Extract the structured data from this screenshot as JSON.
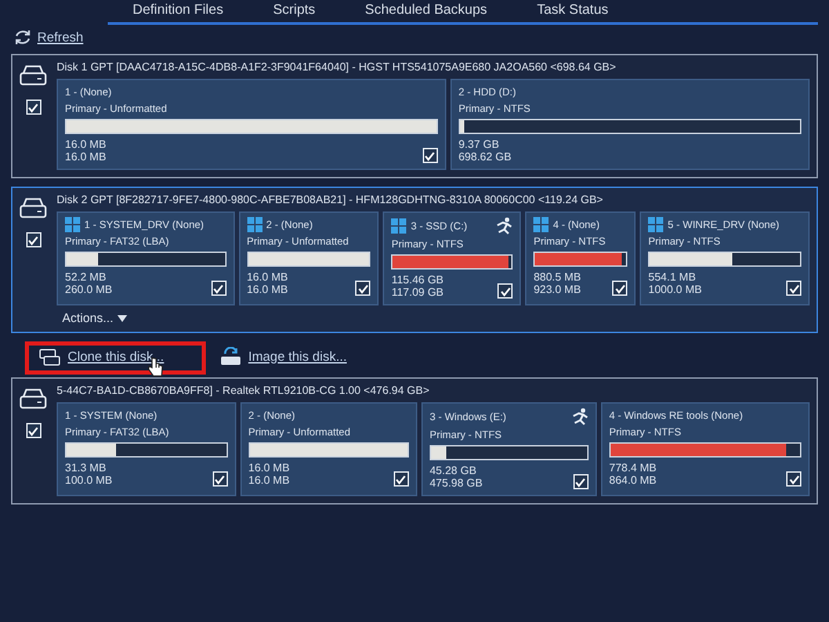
{
  "tabs": [
    {
      "label": "Definition Files",
      "selected": false
    },
    {
      "label": "Scripts",
      "selected": false
    },
    {
      "label": "Scheduled Backups",
      "selected": false
    },
    {
      "label": "Task Status",
      "selected": false
    }
  ],
  "refresh": {
    "label": "Refresh"
  },
  "disks": [
    {
      "header": "Disk 1 GPT [DAAC4718-A15C-4DB8-A1F2-3F9041F64040] - HGST HTS541075A9E680 JA2OA560  <698.64 GB>",
      "selected": false,
      "checked": true,
      "partitions": [
        {
          "name": "1 - (None)",
          "type": "Primary - Unformatted",
          "kind": "plain",
          "boot": false,
          "level": 1,
          "color": "#e4e4e0",
          "used": "16.0 MB",
          "total": "16.0 MB",
          "checked": true
        },
        {
          "name": "2 - HDD (D:)",
          "type": "Primary - NTFS",
          "kind": "plain",
          "boot": false,
          "level": 0.013,
          "color": "#e4e4e0",
          "used": "9.37 GB",
          "total": "698.62 GB"
        }
      ]
    },
    {
      "header": "Disk 2 GPT [8F282717-9FE7-4800-980C-AFBE7B08AB21] - HFM128GDHTNG-8310A 80060C00  <119.24 GB>",
      "selected": true,
      "checked": true,
      "actions": "Actions...",
      "partitions": [
        {
          "name": "1 - SYSTEM_DRV (None)",
          "type": "Primary - FAT32 (LBA)",
          "kind": "windows",
          "boot": false,
          "level": 0.2,
          "color": "#e4e4e0",
          "used": "52.2 MB",
          "total": "260.0 MB",
          "checked": true
        },
        {
          "name": "2 - (None)",
          "type": "Primary - Unformatted",
          "kind": "windows",
          "boot": false,
          "level": 1,
          "color": "#e4e4e0",
          "used": "16.0 MB",
          "total": "16.0 MB",
          "checked": true
        },
        {
          "name": "3 - SSD (C:)",
          "type": "Primary - NTFS",
          "kind": "windows",
          "boot": true,
          "level": 0.98,
          "color": "#e0443c",
          "used": "115.46 GB",
          "total": "117.09 GB",
          "checked": true
        },
        {
          "name": "4 - (None)",
          "type": "Primary - NTFS",
          "kind": "windows",
          "boot": false,
          "level": 0.95,
          "color": "#e0443c",
          "used": "880.5 MB",
          "total": "923.0 MB",
          "checked": true
        },
        {
          "name": "5 - WINRE_DRV (None)",
          "type": "Primary - NTFS",
          "kind": "windows",
          "boot": false,
          "level": 0.55,
          "color": "#e4e4e0",
          "used": "554.1 MB",
          "total": "1000.0 MB",
          "checked": true
        }
      ]
    },
    {
      "header": "5-44C7-BA1D-CB8670BA9FF8] - Realtek RTL9210B-CG 1.00  <476.94 GB>",
      "selected": false,
      "checked": true,
      "partitions": [
        {
          "name": "1 - SYSTEM (None)",
          "type": "Primary - FAT32 (LBA)",
          "kind": "plain",
          "boot": false,
          "level": 0.31,
          "color": "#e4e4e0",
          "used": "31.3 MB",
          "total": "100.0 MB",
          "checked": true
        },
        {
          "name": "2 - (None)",
          "type": "Primary - Unformatted",
          "kind": "plain",
          "boot": false,
          "level": 1,
          "color": "#e4e4e0",
          "used": "16.0 MB",
          "total": "16.0 MB",
          "checked": true
        },
        {
          "name": "3 - Windows (E:)",
          "type": "Primary - NTFS",
          "kind": "plain",
          "boot": true,
          "level": 0.1,
          "color": "#e4e4e0",
          "used": "45.28 GB",
          "total": "475.98 GB",
          "checked": true
        },
        {
          "name": "4 - Windows RE tools (None)",
          "type": "Primary - NTFS",
          "kind": "plain",
          "boot": false,
          "level": 0.93,
          "color": "#e0443c",
          "used": "778.4 MB",
          "total": "864.0 MB",
          "checked": true
        }
      ]
    }
  ],
  "disk_links": [
    {
      "kind": "clone",
      "label": "Clone this disk...",
      "highlighted": true
    },
    {
      "kind": "image",
      "label": "Image this disk...",
      "highlighted": false
    }
  ]
}
